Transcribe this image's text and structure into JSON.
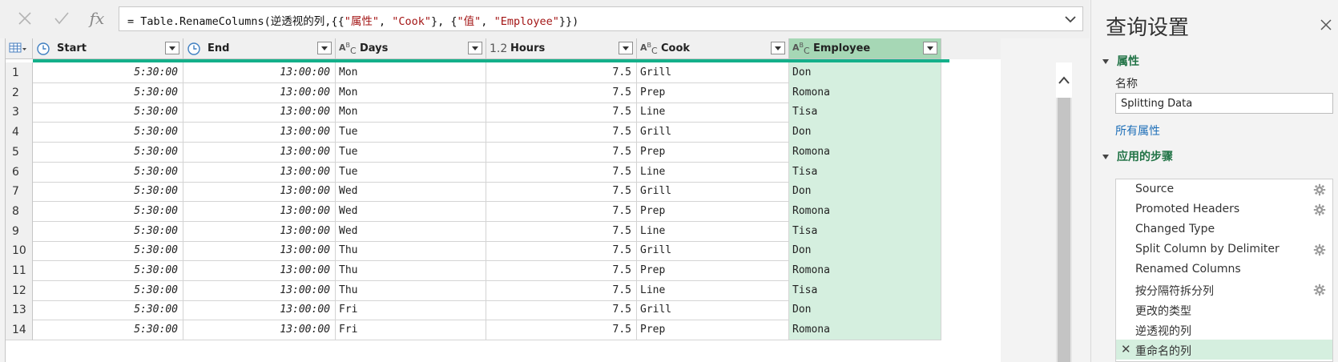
{
  "formula_bar": {
    "cancel_icon": "close-x",
    "commit_icon": "checkmark",
    "fx_label": "fx",
    "formula_prefix": "= Table.RenameColumns(逆透视的列,{{",
    "str1": "\"属性\"",
    "sep1": ", ",
    "str2": "\"Cook\"",
    "sep2": "}, {",
    "str3": "\"值\"",
    "sep3": ", ",
    "str4": "\"Employee\"",
    "suffix": "}})"
  },
  "table": {
    "columns": [
      {
        "name": "Start",
        "type_icon": "clock"
      },
      {
        "name": "End",
        "type_icon": "clock"
      },
      {
        "name": "Days",
        "type_icon": "ABC"
      },
      {
        "name": "Hours",
        "type_icon": "1.2"
      },
      {
        "name": "Cook",
        "type_icon": "ABC"
      },
      {
        "name": "Employee",
        "type_icon": "ABC",
        "selected": true
      }
    ],
    "rows": [
      {
        "num": "1",
        "start": "5:30:00",
        "end": "13:00:00",
        "days": "Mon",
        "hours": "7.5",
        "cook": "Grill",
        "employee": "Don"
      },
      {
        "num": "2",
        "start": "5:30:00",
        "end": "13:00:00",
        "days": "Mon",
        "hours": "7.5",
        "cook": "Prep",
        "employee": "Romona"
      },
      {
        "num": "3",
        "start": "5:30:00",
        "end": "13:00:00",
        "days": "Mon",
        "hours": "7.5",
        "cook": "Line",
        "employee": "Tisa"
      },
      {
        "num": "4",
        "start": "5:30:00",
        "end": "13:00:00",
        "days": "Tue",
        "hours": "7.5",
        "cook": "Grill",
        "employee": "Don"
      },
      {
        "num": "5",
        "start": "5:30:00",
        "end": "13:00:00",
        "days": "Tue",
        "hours": "7.5",
        "cook": "Prep",
        "employee": "Romona"
      },
      {
        "num": "6",
        "start": "5:30:00",
        "end": "13:00:00",
        "days": "Tue",
        "hours": "7.5",
        "cook": "Line",
        "employee": "Tisa"
      },
      {
        "num": "7",
        "start": "5:30:00",
        "end": "13:00:00",
        "days": "Wed",
        "hours": "7.5",
        "cook": "Grill",
        "employee": "Don"
      },
      {
        "num": "8",
        "start": "5:30:00",
        "end": "13:00:00",
        "days": "Wed",
        "hours": "7.5",
        "cook": "Prep",
        "employee": "Romona"
      },
      {
        "num": "9",
        "start": "5:30:00",
        "end": "13:00:00",
        "days": "Wed",
        "hours": "7.5",
        "cook": "Line",
        "employee": "Tisa"
      },
      {
        "num": "10",
        "start": "5:30:00",
        "end": "13:00:00",
        "days": "Thu",
        "hours": "7.5",
        "cook": "Grill",
        "employee": "Don"
      },
      {
        "num": "11",
        "start": "5:30:00",
        "end": "13:00:00",
        "days": "Thu",
        "hours": "7.5",
        "cook": "Prep",
        "employee": "Romona"
      },
      {
        "num": "12",
        "start": "5:30:00",
        "end": "13:00:00",
        "days": "Thu",
        "hours": "7.5",
        "cook": "Line",
        "employee": "Tisa"
      },
      {
        "num": "13",
        "start": "5:30:00",
        "end": "13:00:00",
        "days": "Fri",
        "hours": "7.5",
        "cook": "Grill",
        "employee": "Don"
      },
      {
        "num": "14",
        "start": "5:30:00",
        "end": "13:00:00",
        "days": "Fri",
        "hours": "7.5",
        "cook": "Prep",
        "employee": "Romona"
      }
    ]
  },
  "settings": {
    "title": "查询设置",
    "properties_header": "属性",
    "name_label": "名称",
    "name_value": "Splitting Data",
    "all_properties_link": "所有属性",
    "steps_header": "应用的步骤",
    "steps": [
      {
        "label": "Source",
        "gear": true
      },
      {
        "label": "Promoted Headers",
        "gear": true
      },
      {
        "label": "Changed Type",
        "gear": false
      },
      {
        "label": "Split Column by Delimiter",
        "gear": true
      },
      {
        "label": "Renamed Columns",
        "gear": false
      },
      {
        "label": "按分隔符拆分列",
        "gear": true
      },
      {
        "label": "更改的类型",
        "gear": false
      },
      {
        "label": "逆透视的列",
        "gear": false
      },
      {
        "label": "重命名的列",
        "gear": false,
        "selected": true
      }
    ]
  },
  "colors": {
    "accent_green": "#217346",
    "quality_bar": "#14b08a",
    "selected_column": "#d5efdf",
    "selected_header": "#a6d7b5",
    "link_blue": "#1e6fb8",
    "string_literal": "#a31515"
  }
}
